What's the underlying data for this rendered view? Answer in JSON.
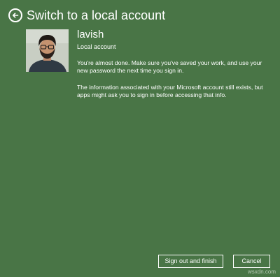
{
  "header": {
    "back_icon": "arrow-left-circle-icon",
    "title": "Switch to a local account"
  },
  "user": {
    "avatar_icon": "user-photo",
    "name": "lavish",
    "account_type": "Local account"
  },
  "body": {
    "paragraph1": "You're almost done. Make sure you've saved your work, and use your new password the next time you sign in.",
    "paragraph2": "The information associated with your Microsoft account still exists, but apps might ask you to sign in before accessing that info."
  },
  "buttons": {
    "finish_label": "Sign out and finish",
    "cancel_label": "Cancel"
  },
  "watermark": "wsxdn.com",
  "colors": {
    "background": "#497546",
    "text": "#ffffff"
  }
}
